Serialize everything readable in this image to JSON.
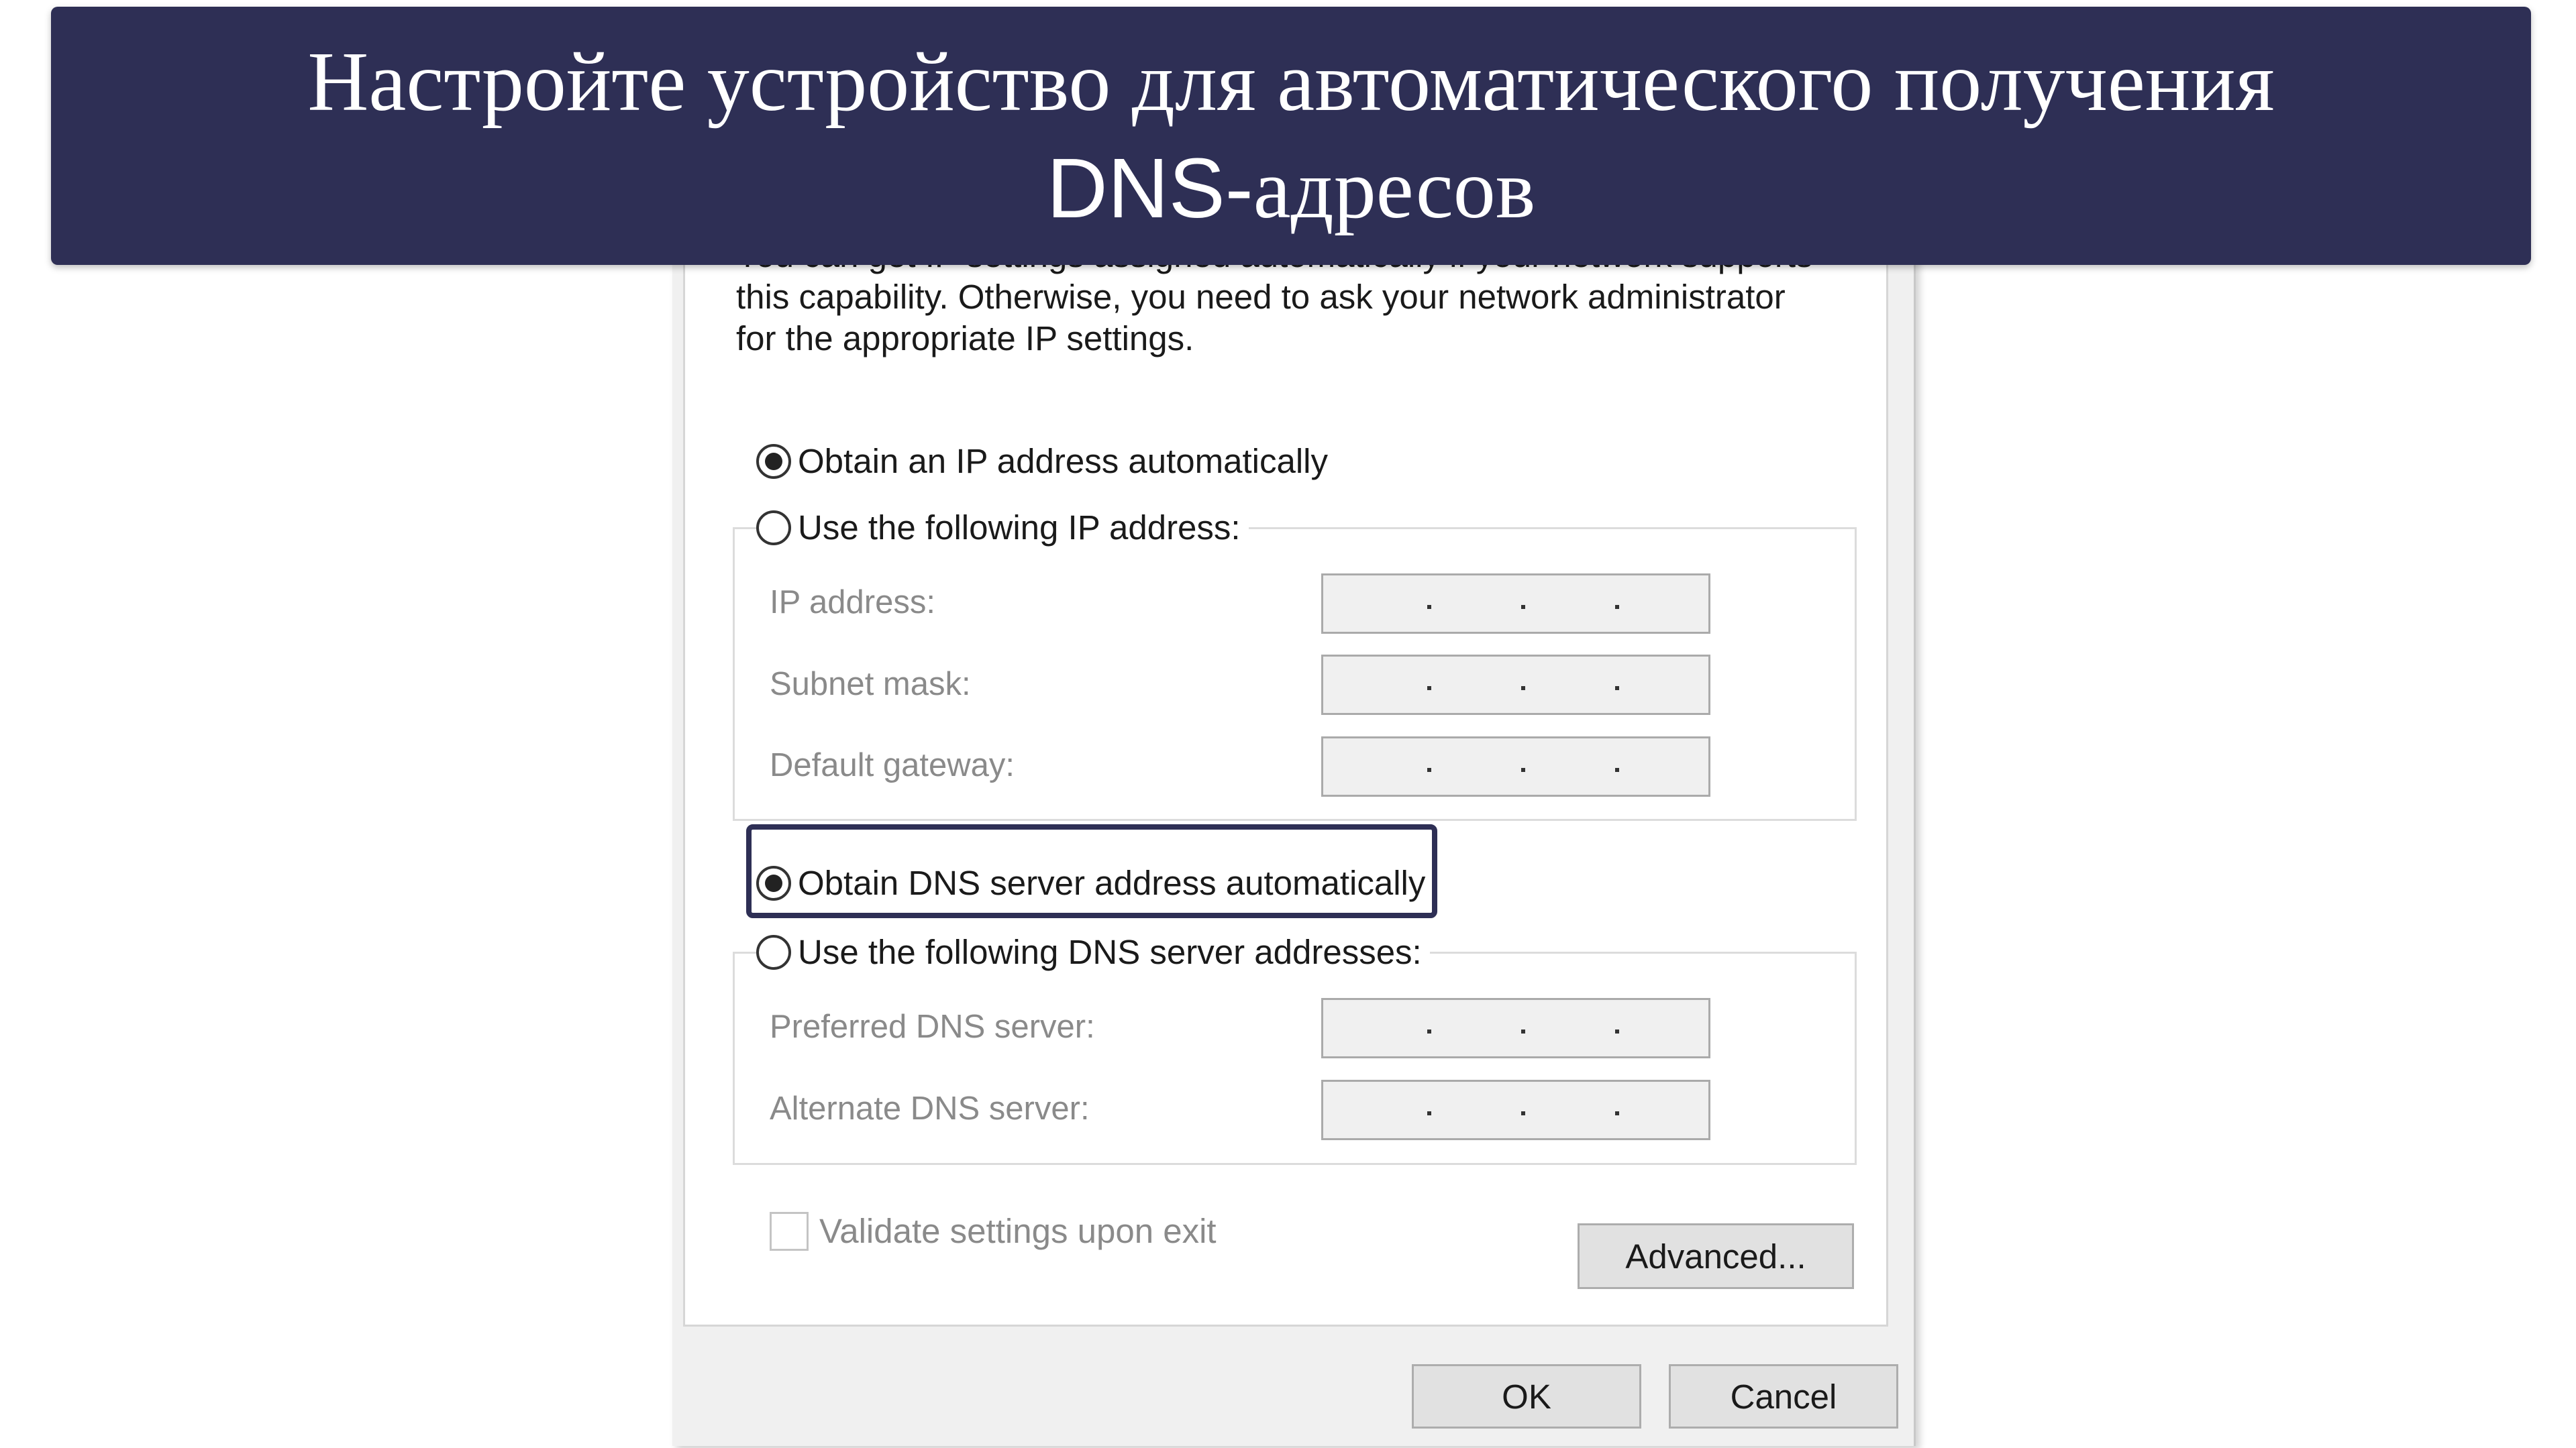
{
  "banner": {
    "line1": "Настройте устройство для автоматического получения",
    "line2_dns": "DNS-",
    "line2_rest": "адресов",
    "background": "#2e2f55"
  },
  "dialog": {
    "intro_partial": "You can get IP settings assigned automatically if your network supports",
    "intro_line2": "this capability. Otherwise, you need to ask your network administrator",
    "intro_line3": "for the appropriate IP settings.",
    "ip_auto": {
      "label": "Obtain an IP address automatically",
      "selected": true
    },
    "ip_manual": {
      "label": "Use the following IP address:",
      "selected": false
    },
    "ip_fields": [
      {
        "label": "IP address:",
        "value": ". . ."
      },
      {
        "label": "Subnet mask:",
        "value": ". . ."
      },
      {
        "label": "Default gateway:",
        "value": ". . ."
      }
    ],
    "dns_auto": {
      "label": "Obtain DNS server address automatically",
      "selected": true,
      "highlighted": true
    },
    "dns_manual": {
      "label": "Use the following DNS server addresses:",
      "selected": false
    },
    "dns_fields": [
      {
        "label": "Preferred DNS server:",
        "value": ". . ."
      },
      {
        "label": "Alternate DNS server:",
        "value": ". . ."
      }
    ],
    "validate_checkbox": {
      "label": "Validate settings upon exit",
      "checked": false
    },
    "advanced_button": "Advanced...",
    "ok_button": "OK",
    "cancel_button": "Cancel"
  }
}
